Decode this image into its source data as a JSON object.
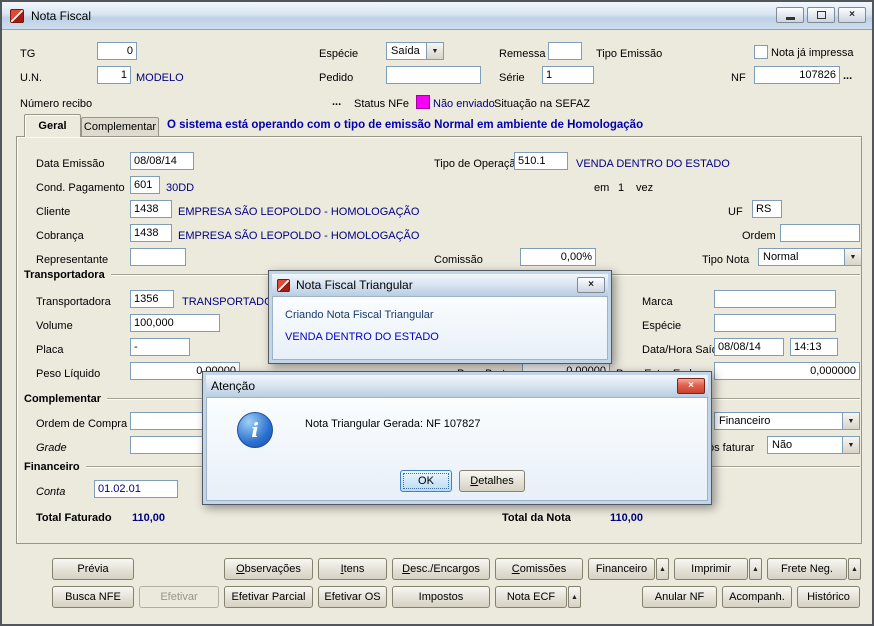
{
  "colors": {
    "navy": "#000080",
    "message_blue": "#0000b0",
    "status_magenta": "#f600f6",
    "accent_focus": "#3c82c4"
  },
  "icons": {
    "dropdown": "▼",
    "dropup": "▲",
    "close": "×",
    "info": "i",
    "ellipsis": "..."
  },
  "window": {
    "title": "Nota Fiscal"
  },
  "header": {
    "tg": {
      "label": "TG",
      "value": "0"
    },
    "especie": {
      "label": "Espécie",
      "value": "Saída"
    },
    "remessa": {
      "label": "Remessa",
      "value": ""
    },
    "tipo_emissao": {
      "label": "Tipo Emissão"
    },
    "nota_ja_impressa": {
      "label": "Nota já impressa"
    },
    "un": {
      "label": "U.N.",
      "value": "1",
      "desc": "MODELO"
    },
    "pedido": {
      "label": "Pedido",
      "value": ""
    },
    "serie": {
      "label": "Série",
      "value": "1"
    },
    "nf": {
      "label": "NF",
      "value": "107826"
    },
    "numero_recibo": {
      "label": "Número recibo"
    },
    "status_nfe": {
      "label": "Status NFe",
      "value": "Não enviado"
    },
    "situacao_sefaz": {
      "label": "Situação na SEFAZ"
    }
  },
  "tabs": {
    "geral": "Geral",
    "complementar": "Complementar",
    "message": "O sistema está operando com o tipo de emissão Normal em ambiente de Homologação"
  },
  "geral": {
    "data_emissao": {
      "label": "Data Emissão",
      "value": "08/08/14"
    },
    "tipo_operacao": {
      "label": "Tipo de Operação",
      "value": "510.1",
      "desc": "VENDA DENTRO DO ESTADO"
    },
    "cond_pagamento": {
      "label": "Cond. Pagamento",
      "value": "601",
      "desc": "30DD",
      "em": "em",
      "vezes": "1",
      "vez": "vez"
    },
    "cliente": {
      "label": "Cliente",
      "value": "1438",
      "desc": "EMPRESA SÃO LEOPOLDO - HOMOLOGAÇÃO"
    },
    "uf": {
      "label": "UF",
      "value": "RS"
    },
    "cobranca": {
      "label": "Cobrança",
      "value": "1438",
      "desc": "EMPRESA SÃO LEOPOLDO - HOMOLOGAÇÃO"
    },
    "ordem": {
      "label": "Ordem",
      "value": ""
    },
    "representante": {
      "label": "Representante",
      "value": ""
    },
    "comissao": {
      "label": "Comissão",
      "value": "0,00%"
    },
    "tipo_nota": {
      "label": "Tipo Nota",
      "value": "Normal"
    },
    "grupo_transportadora": {
      "title": "Transportadora",
      "transportadora": {
        "label": "Transportadora",
        "value": "1356",
        "desc": "TRANSPORTADOR"
      },
      "marca": {
        "label": "Marca",
        "value": ""
      },
      "volume": {
        "label": "Volume",
        "value": "100,000"
      },
      "especie": {
        "label": "Espécie",
        "value": ""
      },
      "placa": {
        "label": "Placa",
        "value": "-"
      },
      "data_hora_saida": {
        "label": "Data/Hora Saída",
        "date": "08/08/14",
        "time": "14:13"
      },
      "peso_liquido": {
        "label": "Peso Líquido",
        "value": "0,00000"
      },
      "peso_bruto": {
        "label": "Peso Bruto",
        "value": "0,00000"
      },
      "peso_extra": {
        "label": "Peso Extra Emb",
        "value": "0,000000"
      }
    },
    "grupo_complementar": {
      "title": "Complementar",
      "ordem_compra": {
        "label": "Ordem de Compra",
        "value": ""
      },
      "grade": {
        "label": "Grade",
        "value": ""
      },
      "frete": {
        "label": "e",
        "value": "Financeiro"
      },
      "apos_faturar": {
        "label": "ós faturar",
        "value": "Não"
      }
    },
    "grupo_financeiro": {
      "title": "Financeiro",
      "conta": {
        "label": "Conta",
        "value": "01.02.01"
      },
      "total_faturado": {
        "label": "Total Faturado",
        "value": "110,00"
      },
      "total_nota": {
        "label": "Total da Nota",
        "value": "110,00"
      }
    }
  },
  "dialogs": {
    "triangular": {
      "title": "Nota Fiscal Triangular",
      "line1": "Criando Nota Fiscal Triangular",
      "line2": "VENDA DENTRO DO ESTADO"
    },
    "atencao": {
      "title": "Atenção",
      "message": "Nota Triangular Gerada: NF 107827",
      "ok": "OK",
      "detalhes": "Detalhes"
    }
  },
  "footer": {
    "row1": [
      "Prévia",
      "Observações",
      "Itens",
      "Desc./Encargos",
      "Comissões",
      "Financeiro",
      "Imprimir",
      "Frete Neg."
    ],
    "row2": [
      "Busca NFE",
      "Efetivar",
      "Efetivar Parcial",
      "Efetivar OS",
      "Impostos",
      "Nota ECF",
      "Anular NF",
      "Acompanh.",
      "Histórico"
    ]
  }
}
